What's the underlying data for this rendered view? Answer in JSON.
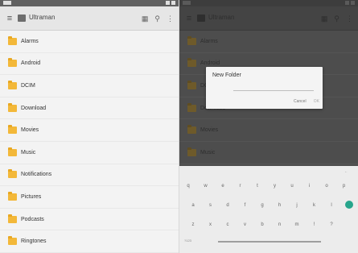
{
  "left": {
    "toolbar_title": "Ultraman",
    "folders": [
      {
        "label": "Alarms"
      },
      {
        "label": "Android"
      },
      {
        "label": "DCIM"
      },
      {
        "label": "Download"
      },
      {
        "label": "Movies"
      },
      {
        "label": "Music"
      },
      {
        "label": "Notifications"
      },
      {
        "label": "Pictures"
      },
      {
        "label": "Podcasts"
      },
      {
        "label": "Ringtones"
      }
    ]
  },
  "right": {
    "toolbar_title": "Ultraman",
    "folders": [
      {
        "label": "Alarms"
      },
      {
        "label": "Android"
      },
      {
        "label": "DCIM"
      },
      {
        "label": "Download"
      },
      {
        "label": "Movies"
      },
      {
        "label": "Music"
      },
      {
        "label": "Notifications"
      },
      {
        "label": "Pictures"
      }
    ],
    "dialog": {
      "title": "New Folder",
      "cancel_label": "Cancel",
      "ok_label": "OK"
    },
    "keyboard": {
      "row1": [
        "q",
        "w",
        "e",
        "r",
        "t",
        "y",
        "u",
        "i",
        "o",
        "p"
      ],
      "row2": [
        "a",
        "s",
        "d",
        "f",
        "g",
        "h",
        "j",
        "k",
        "l"
      ],
      "row3": [
        "z",
        "x",
        "c",
        "v",
        "b",
        "n",
        "m",
        "!",
        "?"
      ],
      "symbols_label": "?123"
    }
  },
  "colors": {
    "folder": "#f3b839",
    "toolbar": "#e6e6e6",
    "accent_key": "#27a58c",
    "overlay": "#4d4d4d"
  }
}
